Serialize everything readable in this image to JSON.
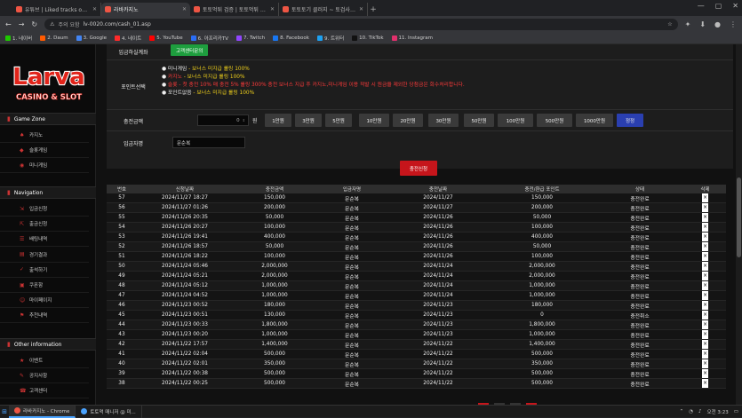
{
  "browser": {
    "tabs": [
      {
        "label": "유튜브 | Liked tracks on Sound",
        "active": false
      },
      {
        "label": "라바카지노",
        "active": true
      },
      {
        "label": "토토먹튀 검증 | 토토먹튀 - 토토",
        "active": false
      },
      {
        "label": "토토토기 클러지 ~ 토검사 - 토",
        "active": false
      }
    ],
    "new_tab": "+",
    "window_controls": [
      "—",
      "▢",
      "✕"
    ],
    "url_security": "주의 요함",
    "url": "lv-0020.com/cash_01.asp",
    "bookmarks": [
      {
        "label": "1. 네이버",
        "color": "#1ec800"
      },
      {
        "label": "2. Daum",
        "color": "#ff5a00"
      },
      {
        "label": "3. Google",
        "color": "#4285f4"
      },
      {
        "label": "4. 네이트",
        "color": "#ff2a2a"
      },
      {
        "label": "5. YouTube",
        "color": "#ff0000"
      },
      {
        "label": "6. 아프리카TV",
        "color": "#2a6df4"
      },
      {
        "label": "7. Twitch",
        "color": "#9146ff"
      },
      {
        "label": "8. Facebook",
        "color": "#1877f2"
      },
      {
        "label": "9. 트위터",
        "color": "#1da1f2"
      },
      {
        "label": "10. TikTok",
        "color": "#111111"
      },
      {
        "label": "11. Instagram",
        "color": "#e1306c"
      }
    ]
  },
  "site": {
    "logo_main": "Larva",
    "logo_sub": "CASINO & SLOT"
  },
  "sidebar": {
    "sections": [
      {
        "title": "Game Zone",
        "items": [
          "카지노",
          "슬롯게임",
          "미니게임"
        ]
      },
      {
        "title": "Navigation",
        "items": [
          "입금신청",
          "출금신청",
          "배팅내역",
          "경기결과",
          "출석하기",
          "쿠폰함",
          "마이페이지",
          "추천내역"
        ]
      },
      {
        "title": "Other information",
        "items": [
          "이벤트",
          "공지사항",
          "고객센터"
        ]
      }
    ]
  },
  "form": {
    "account_label": "입금하실계좌",
    "consult_button": "고객센터문의",
    "points_label": "포인트선택",
    "points": [
      {
        "name": "미니게임",
        "text": " - 보너스 미지급 롤링 100%",
        "color": "yellow"
      },
      {
        "name": "카지노",
        "text": " - 보너스 미지급 롤링 100%",
        "color": "yellow"
      },
      {
        "name": "슬롯",
        "text": " - 첫 충전 10% 매 충전 5% 롤링 300% 충전 보너스 지급 후 카지노,미니게임 이용 적발 시 원금을 제외한 당첨금은 회수처리합니다.",
        "color": "red"
      },
      {
        "name": "포인트없음",
        "text": " - 보너스 미지급 롤링 100%",
        "color": "yellow"
      }
    ],
    "amount_label": "충전금액",
    "amount_value": "0",
    "amount_unit": "원",
    "amount_buttons": [
      "1만원",
      "3만원",
      "5만원",
      "10만원",
      "20만원",
      "30만원",
      "50만원",
      "100만원",
      "500만원",
      "1000만원"
    ],
    "reset_button": "정정",
    "depositor_label": "입금자명",
    "depositor_value": "문순복",
    "submit_button": "충전신청"
  },
  "history": {
    "columns": [
      "번호",
      "신청날짜",
      "충전금액",
      "입금자명",
      "충전날짜",
      "충전/환급 포인트",
      "상태",
      "삭제"
    ],
    "rows": [
      [
        "57",
        "2024/11/27 18:27",
        "150,000",
        "문순복",
        "2024/11/27",
        "150,000",
        "충전완료",
        "×"
      ],
      [
        "56",
        "2024/11/27 01:26",
        "200,000",
        "문순복",
        "2024/11/27",
        "200,000",
        "충전완료",
        "×"
      ],
      [
        "55",
        "2024/11/26 20:35",
        "50,000",
        "문순복",
        "2024/11/26",
        "50,000",
        "충전완료",
        "×"
      ],
      [
        "54",
        "2024/11/26 20:27",
        "100,000",
        "문순복",
        "2024/11/26",
        "100,000",
        "충전완료",
        "×"
      ],
      [
        "53",
        "2024/11/26 19:41",
        "400,000",
        "문순복",
        "2024/11/26",
        "400,000",
        "충전완료",
        "×"
      ],
      [
        "52",
        "2024/11/26 18:57",
        "50,000",
        "문순복",
        "2024/11/26",
        "50,000",
        "충전완료",
        "×"
      ],
      [
        "51",
        "2024/11/26 18:22",
        "100,000",
        "문순복",
        "2024/11/26",
        "100,000",
        "충전완료",
        "×"
      ],
      [
        "50",
        "2024/11/24 05:46",
        "2,000,000",
        "문순복",
        "2024/11/24",
        "2,000,000",
        "충전완료",
        "×"
      ],
      [
        "49",
        "2024/11/24 05:21",
        "2,000,000",
        "문순복",
        "2024/11/24",
        "2,000,000",
        "충전완료",
        "×"
      ],
      [
        "48",
        "2024/11/24 05:12",
        "1,000,000",
        "문순복",
        "2024/11/24",
        "1,000,000",
        "충전완료",
        "×"
      ],
      [
        "47",
        "2024/11/24 04:52",
        "1,000,000",
        "문순복",
        "2024/11/24",
        "1,000,000",
        "충전완료",
        "×"
      ],
      [
        "46",
        "2024/11/23 00:52",
        "180,000",
        "문순복",
        "2024/11/23",
        "180,000",
        "충전완료",
        "×"
      ],
      [
        "45",
        "2024/11/23 00:51",
        "130,000",
        "문순복",
        "2024/11/23",
        "0",
        "충전취소",
        "×"
      ],
      [
        "44",
        "2024/11/23 00:33",
        "1,800,000",
        "문순복",
        "2024/11/23",
        "1,800,000",
        "충전완료",
        "×"
      ],
      [
        "43",
        "2024/11/23 00:20",
        "1,000,000",
        "문순복",
        "2024/11/23",
        "1,000,000",
        "충전완료",
        "×"
      ],
      [
        "42",
        "2024/11/22 17:57",
        "1,400,000",
        "문순복",
        "2024/11/22",
        "1,400,000",
        "충전완료",
        "×"
      ],
      [
        "41",
        "2024/11/22 02:04",
        "500,000",
        "문순복",
        "2024/11/22",
        "500,000",
        "충전완료",
        "×"
      ],
      [
        "40",
        "2024/11/22 02:01",
        "350,000",
        "문순복",
        "2024/11/22",
        "350,000",
        "충전완료",
        "×"
      ],
      [
        "39",
        "2024/11/22 00:38",
        "500,000",
        "문순복",
        "2024/11/22",
        "500,000",
        "충전완료",
        "×"
      ],
      [
        "38",
        "2024/11/22 00:25",
        "500,000",
        "문순복",
        "2024/11/22",
        "500,000",
        "충전완료",
        "×"
      ]
    ]
  },
  "taskbar": {
    "items": [
      {
        "label": "라바카지노 - Chrome",
        "color": "#e54",
        "active": true
      },
      {
        "label": "토토먹 매니저 @ 미...",
        "color": "#4aa3ff",
        "active": false
      }
    ],
    "clock": "오전 3:23"
  }
}
